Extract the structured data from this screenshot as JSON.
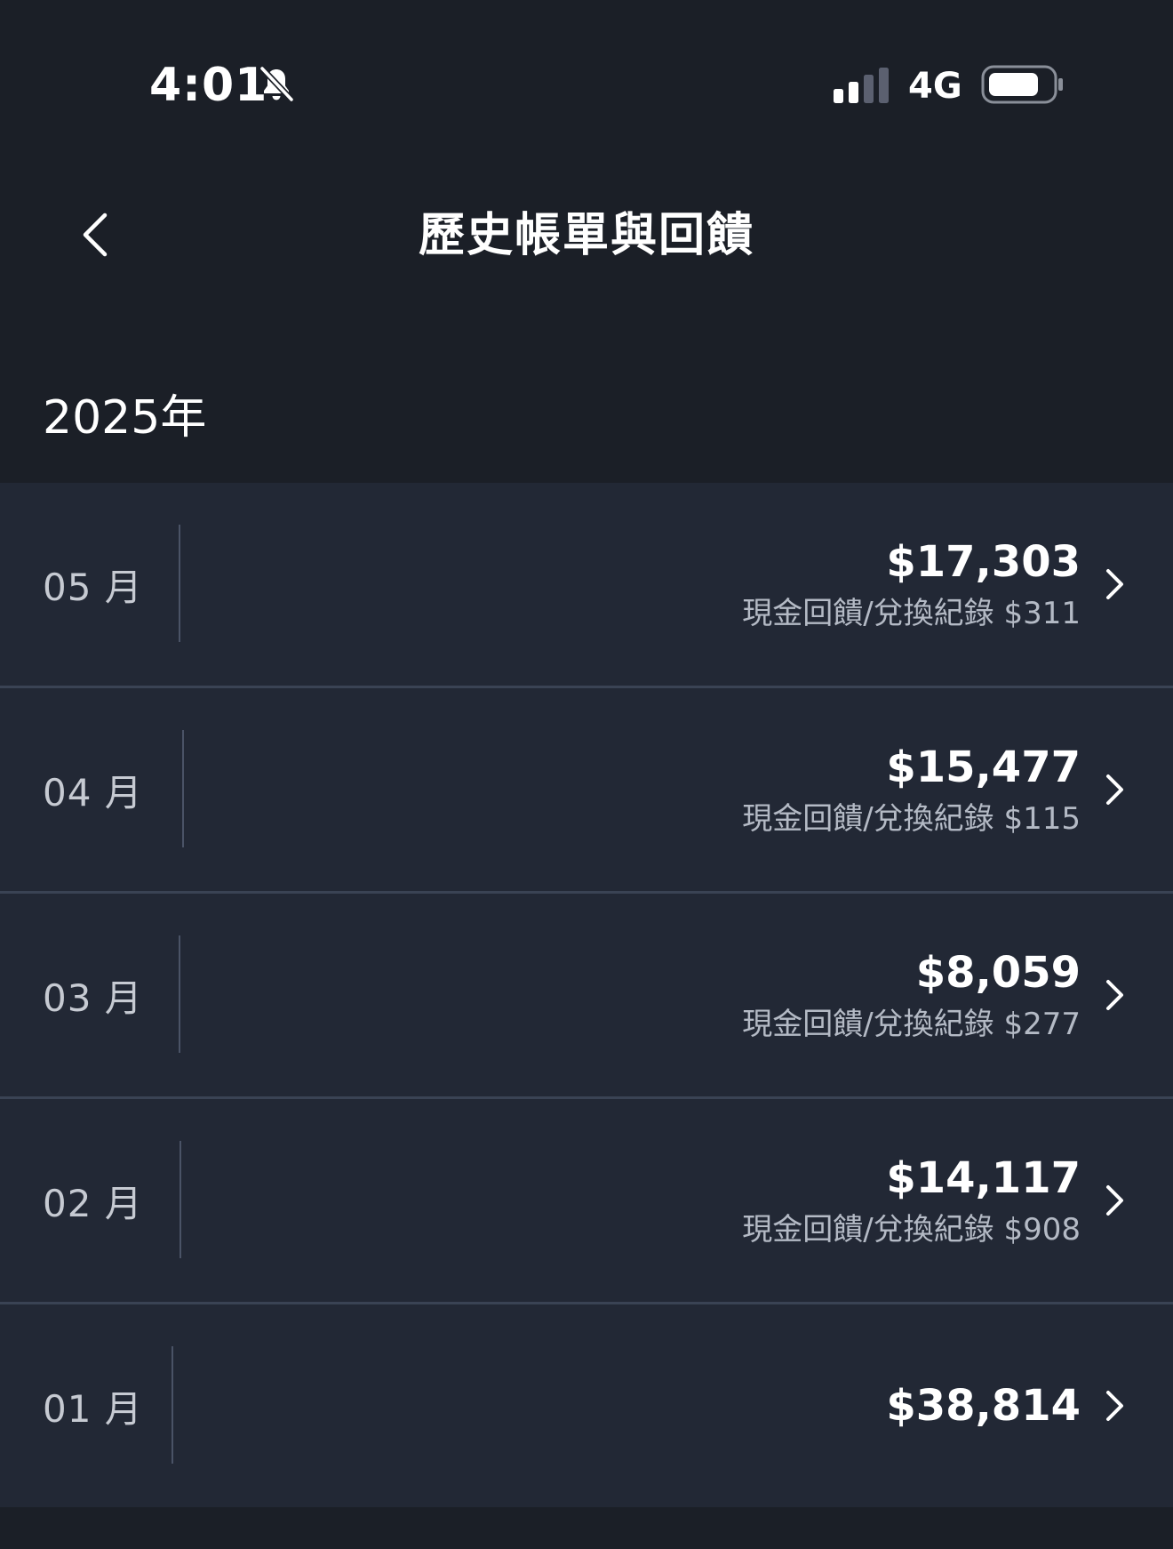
{
  "status_bar": {
    "time": "4:01",
    "network": "4G",
    "icons": [
      "bell-slash-icon",
      "signal-bars-icon",
      "battery-icon"
    ]
  },
  "nav": {
    "back_icon": "chevron-left-icon",
    "title": "歷史帳單與回饋"
  },
  "year_label": "2025年",
  "months": [
    {
      "month": "05 月",
      "amount": "$17,303",
      "cashback": "現金回饋/兌換紀錄 $311"
    },
    {
      "month": "04 月",
      "amount": "$15,477",
      "cashback": "現金回饋/兌換紀錄 $115"
    },
    {
      "month": "03 月",
      "amount": "$8,059",
      "cashback": "現金回饋/兌換紀錄 $277"
    },
    {
      "month": "02 月",
      "amount": "$14,117",
      "cashback": "現金回饋/兌換紀錄 $908"
    },
    {
      "month": "01 月",
      "amount": "$38,814"
    }
  ],
  "colors": {
    "background": "#1b1f27",
    "row_background": "#222835",
    "divider": "#3a4354",
    "text_primary": "#ffffff",
    "text_secondary": "#b4bac5"
  }
}
